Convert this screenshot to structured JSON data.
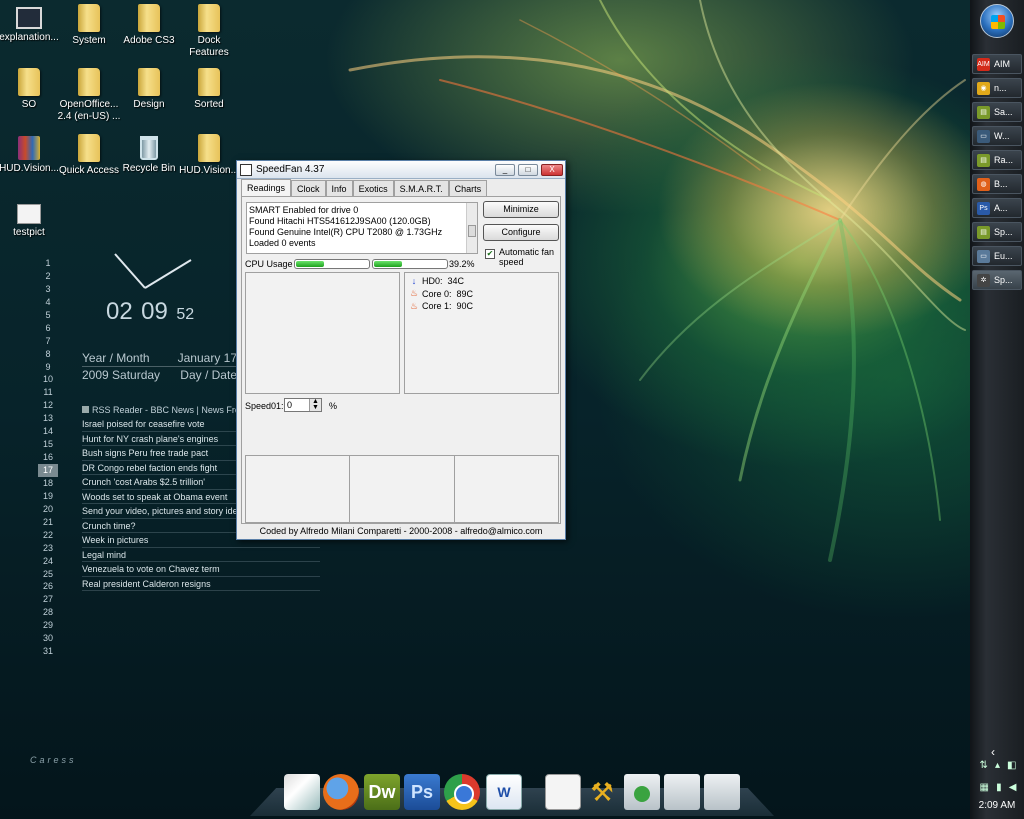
{
  "desktop_icons": [
    {
      "label": "explanation...",
      "icon": "monitor-icon"
    },
    {
      "label": "System",
      "icon": "folder-icon"
    },
    {
      "label": "Adobe CS3",
      "icon": "folder-icon"
    },
    {
      "label": "Dock Features",
      "icon": "folder-icon"
    },
    {
      "label": "SO",
      "icon": "folder-icon"
    },
    {
      "label": "OpenOffice... 2.4 (en-US) ...",
      "icon": "folder-icon"
    },
    {
      "label": "Design",
      "icon": "folder-icon"
    },
    {
      "label": "Sorted",
      "icon": "folder-icon"
    },
    {
      "label": "HUD.Vision...",
      "icon": "archive-icon"
    },
    {
      "label": "Quick Access",
      "icon": "folder-icon"
    },
    {
      "label": "Recycle Bin",
      "icon": "recycle-bin-icon"
    },
    {
      "label": "HUD.Vision...",
      "icon": "folder-icon"
    },
    {
      "label": "testpict",
      "icon": "image-file-icon"
    }
  ],
  "clock": {
    "hours": "02",
    "minutes": "09",
    "seconds": "52"
  },
  "calendar": {
    "days": [
      "1",
      "2",
      "3",
      "4",
      "5",
      "6",
      "7",
      "8",
      "9",
      "10",
      "11",
      "12",
      "13",
      "14",
      "15",
      "16",
      "17",
      "18",
      "19",
      "20",
      "21",
      "22",
      "23",
      "24",
      "25",
      "26",
      "27",
      "28",
      "29",
      "30",
      "31"
    ],
    "today": "17",
    "year_month_label": "Year / Month",
    "month_day": "January 17",
    "year_weekday": "2009 Saturday",
    "day_date_label": "Day / Date"
  },
  "rss": {
    "title": "RSS Reader - BBC News | News Fron",
    "items": [
      "Israel poised for ceasefire vote",
      "Hunt for NY crash plane's engines",
      "Bush signs Peru free trade pact",
      "DR Congo rebel faction ends fight",
      "Crunch 'cost Arabs $2.5 trillion'",
      "Woods set to speak at Obama event",
      "Send your video, pictures and story ide",
      "Crunch time?",
      "Week in pictures",
      "Legal mind",
      "Venezuela to vote on Chavez term",
      "Real president Calderon resigns"
    ]
  },
  "caress_text": "Caress",
  "speedfan": {
    "title": "SpeedFan 4.37",
    "window_buttons": {
      "minimize": "_",
      "maximize": "□",
      "close": "X"
    },
    "tabs": [
      "Readings",
      "Clock",
      "Info",
      "Exotics",
      "S.M.A.R.T.",
      "Charts"
    ],
    "active_tab": "Readings",
    "log": [
      "SMART Enabled for drive 0",
      "Found Hitachi HTS541612J9SA00 (120.0GB)",
      "Found Genuine Intel(R) CPU T2080 @ 1.73GHz",
      "Loaded 0 events"
    ],
    "minimize_label": "Minimize",
    "configure_label": "Configure",
    "auto_fan_label": "Automatic fan speed",
    "auto_fan_checked": true,
    "cpu_label": "CPU Usage",
    "cpu_bars": [
      0.39,
      0.39
    ],
    "cpu_percent": "39.2%",
    "temps": [
      {
        "label": "HD0:",
        "value": "34C",
        "icon": "down-arrow-icon"
      },
      {
        "label": "Core 0:",
        "value": "89C",
        "icon": "flame-icon"
      },
      {
        "label": "Core 1:",
        "value": "90C",
        "icon": "flame-icon"
      }
    ],
    "speed_label": "Speed01:",
    "speed_value": "0",
    "speed_unit": "%",
    "footer": "Coded by Alfredo Milani Comparetti - 2000-2008 - alfredo@almico.com"
  },
  "dock": [
    "photo-viewer",
    "firefox",
    "dreamweaver",
    "photoshop",
    "chrome",
    "word",
    "document",
    "tools",
    "downloads-folder",
    "folder",
    "documents-folder"
  ],
  "dock_labels": {
    "dreamweaver": "Dw",
    "photoshop": "Ps",
    "word": "W"
  },
  "taskbar": {
    "items": [
      {
        "label": "AIM",
        "icon": "aim-icon",
        "color": "#d32a1a",
        "glyph": "AIM"
      },
      {
        "label": "n...",
        "icon": "chrome-icon",
        "color": "#e2a91a",
        "glyph": "◉"
      },
      {
        "label": "Sa...",
        "icon": "document-icon",
        "color": "#7a9a2a",
        "glyph": "▤"
      },
      {
        "label": "W...",
        "icon": "monitor-icon",
        "color": "#3a5a7a",
        "glyph": "▭"
      },
      {
        "label": "Ra...",
        "icon": "document-icon",
        "color": "#7a9a2a",
        "glyph": "▤"
      },
      {
        "label": "B...",
        "icon": "firefox-icon",
        "color": "#e0601a",
        "glyph": "◍"
      },
      {
        "label": "A...",
        "icon": "photoshop-icon",
        "color": "#2a5aa8",
        "glyph": "Ps"
      },
      {
        "label": "Sp...",
        "icon": "document-icon",
        "color": "#7a9a2a",
        "glyph": "▤"
      },
      {
        "label": "Eu...",
        "icon": "window-icon",
        "color": "#5a7a9a",
        "glyph": "▭"
      },
      {
        "label": "Sp...",
        "icon": "fan-icon",
        "color": "#444",
        "glyph": "✲"
      }
    ],
    "active_index": 9,
    "time": "2:09 AM"
  }
}
